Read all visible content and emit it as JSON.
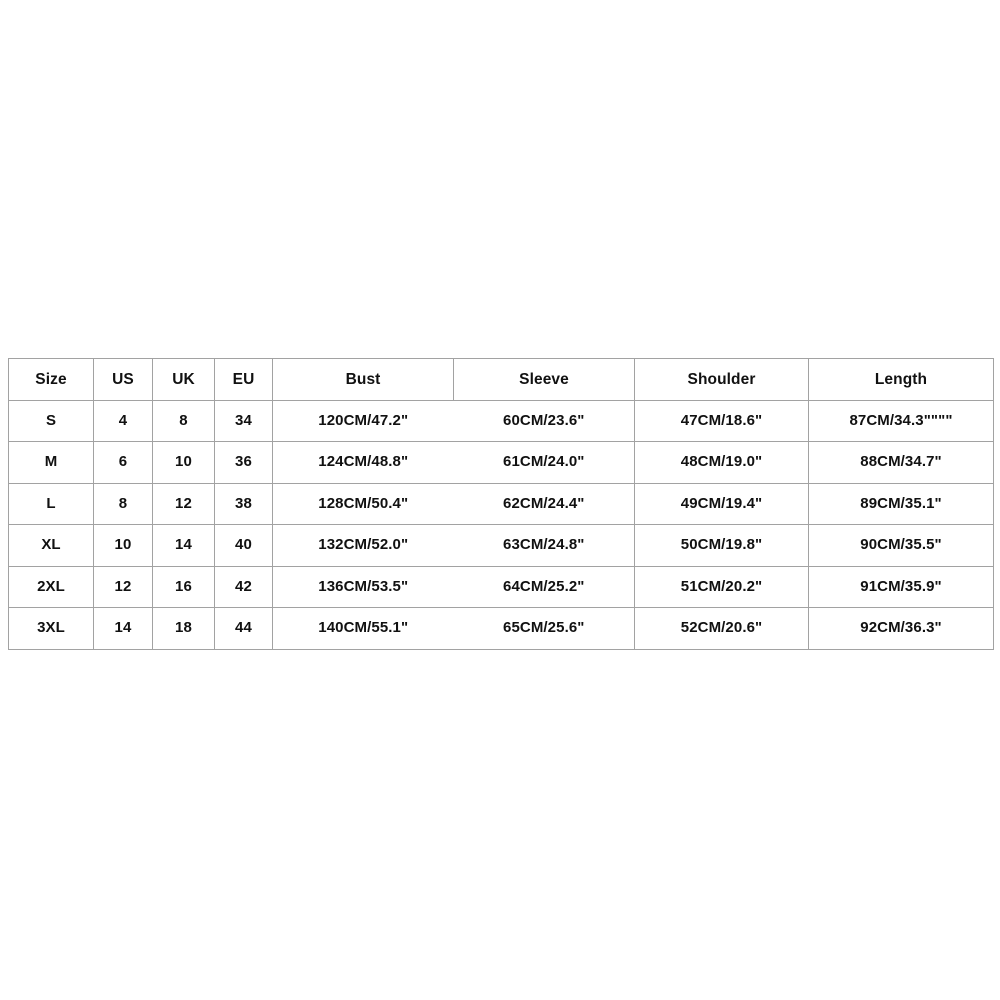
{
  "table": {
    "name": "size-chart",
    "border_color": "#a2a2a2",
    "text_color": "#111111",
    "background": "#ffffff",
    "headers": [
      "Size",
      "US",
      "UK",
      "EU",
      "Bust",
      "Sleeve",
      "Shoulder",
      "Length"
    ],
    "rows": [
      {
        "size": "S",
        "us": "4",
        "uk": "8",
        "eu": "34",
        "bust": "120CM/47.2\"",
        "sleeve": "60CM/23.6\"",
        "shoulder": "47CM/18.6\"",
        "length": "87CM/34.3\"\"\"\""
      },
      {
        "size": "M",
        "us": "6",
        "uk": "10",
        "eu": "36",
        "bust": "124CM/48.8\"",
        "sleeve": "61CM/24.0\"",
        "shoulder": "48CM/19.0\"",
        "length": "88CM/34.7\""
      },
      {
        "size": "L",
        "us": "8",
        "uk": "12",
        "eu": "38",
        "bust": "128CM/50.4\"",
        "sleeve": "62CM/24.4\"",
        "shoulder": "49CM/19.4\"",
        "length": "89CM/35.1\""
      },
      {
        "size": "XL",
        "us": "10",
        "uk": "14",
        "eu": "40",
        "bust": "132CM/52.0\"",
        "sleeve": "63CM/24.8\"",
        "shoulder": "50CM/19.8\"",
        "length": "90CM/35.5\""
      },
      {
        "size": "2XL",
        "us": "12",
        "uk": "16",
        "eu": "42",
        "bust": "136CM/53.5\"",
        "sleeve": "64CM/25.2\"",
        "shoulder": "51CM/20.2\"",
        "length": "91CM/35.9\""
      },
      {
        "size": "3XL",
        "us": "14",
        "uk": "18",
        "eu": "44",
        "bust": "140CM/55.1\"",
        "sleeve": "65CM/25.6\"",
        "shoulder": "52CM/20.6\"",
        "length": "92CM/36.3\""
      }
    ]
  }
}
